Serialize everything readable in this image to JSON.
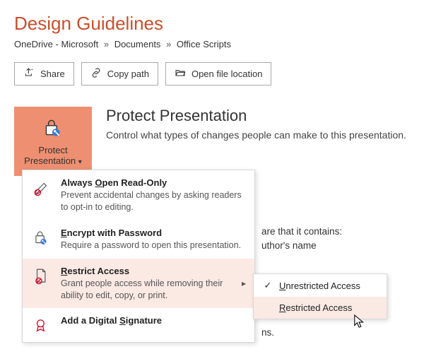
{
  "title": "Design Guidelines",
  "breadcrumb": {
    "parts": [
      "OneDrive - Microsoft",
      "Documents",
      "Office Scripts"
    ]
  },
  "actions": {
    "share": "Share",
    "copy": "Copy path",
    "open": "Open file location"
  },
  "protect": {
    "button_line1": "Protect",
    "button_line2": "Presentation",
    "heading": "Protect Presentation",
    "desc": "Control what types of changes people can make to this presentation."
  },
  "menu": {
    "readonly": {
      "title_pre": "Always ",
      "title_ul": "O",
      "title_post": "pen Read-Only",
      "desc": "Prevent accidental changes by asking readers to opt-in to editing."
    },
    "encrypt": {
      "title_ul": "E",
      "title_post": "ncrypt with Password",
      "desc": "Require a password to open this presentation."
    },
    "restrict": {
      "title_ul": "R",
      "title_post": "estrict Access",
      "desc": "Grant people access while removing their ability to edit, copy, or print."
    },
    "sign": {
      "title_pre": "Add a Digital ",
      "title_ul": "S",
      "title_post": "ignature",
      "desc": ""
    }
  },
  "submenu": {
    "unrestricted": {
      "ul": "U",
      "post": "nrestricted Access"
    },
    "restricted": {
      "ul": "R",
      "post": "estricted Access"
    }
  },
  "bg": {
    "line1": "are that it contains:",
    "line2": "uthor's name",
    "line3": "ns."
  },
  "check": "✓"
}
